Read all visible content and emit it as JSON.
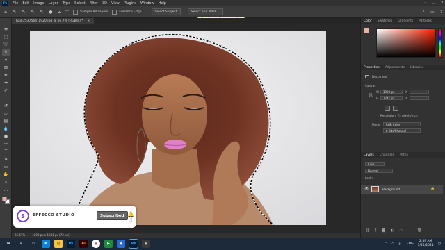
{
  "app": {
    "logo": "Ps",
    "menu": [
      "File",
      "Edit",
      "Image",
      "Layer",
      "Type",
      "Select",
      "Filter",
      "3D",
      "View",
      "Plugins",
      "Window",
      "Help"
    ],
    "window_controls": [
      "–",
      "□",
      "✕"
    ]
  },
  "options_bar": {
    "brush_size": "5°",
    "sample_all_layers": "Sample All Layers",
    "enhance_edge": "Enhance Edge",
    "select_subject": "Select Subject",
    "select_mask": "Select and Mask...",
    "tooltip": "Create or refine a selection"
  },
  "document": {
    "tab_title": "hair-2537564_1920.jpg @ 66.7% (RGB/8) *",
    "tab_close": "×",
    "zoom": "66.67%",
    "doc_info": "1800 px x 1241 px (72 ppi)"
  },
  "color_panel": {
    "tabs": [
      "Color",
      "Swatches",
      "Gradients",
      "Patterns"
    ]
  },
  "properties_panel": {
    "tabs": [
      "Properties",
      "Adjustments",
      "Libraries"
    ],
    "document_label": "Document",
    "canvas_heading": "Canvas",
    "w_label": "W",
    "w_value": "1920 px",
    "h_label": "H",
    "h_value": "1241 px",
    "x_label": "X",
    "y_label": "Y",
    "resolution": "Resolution: 72 pixels/inch",
    "mode_label": "Mode",
    "mode_value": "RGB Color",
    "bit_value": "8 Bits/Channel"
  },
  "layers_panel": {
    "tabs": [
      "Layers",
      "Channels",
      "Paths"
    ],
    "kind": "Kind",
    "blend": "Normal",
    "lock": "Lock:",
    "layer_name": "Background"
  },
  "taskbar": {
    "lang": "ENG",
    "time": "2:39 AM",
    "date": "3/24/2021"
  },
  "watermark": {
    "studio": "EFFECCO STUDIO",
    "subscribed": "Subscribed"
  },
  "colors": {
    "ps_blue": "#31a8ff",
    "ps_dark": "#001e36",
    "hue_red": "#ff2000",
    "selection": "#ffffff"
  }
}
